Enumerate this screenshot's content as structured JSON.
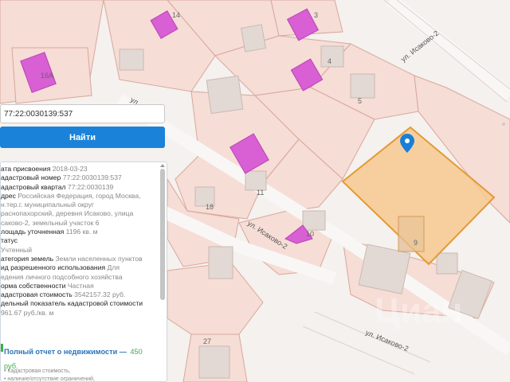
{
  "search": {
    "value": "77:22:0030139:537",
    "button_label": "Найти"
  },
  "streets": [
    "ул. Исаково-2",
    "ул. Исаково-2",
    "ул. Исаково-2",
    "ул."
  ],
  "plot_numbers": [
    "14",
    "3",
    "16А",
    "4",
    "5",
    "11",
    "18",
    "10",
    "9",
    "27"
  ],
  "watermark": "Циан",
  "info": {
    "rows": [
      {
        "label": "ата присвоения",
        "value": "2018-03-23"
      },
      {
        "label": "адастровый номер",
        "value": "77:22:0030139:537"
      },
      {
        "label": "адастровый квартал",
        "value": "77:22:0030139"
      },
      {
        "label": "дрес",
        "value": "Российская Федерация, город Москва,"
      },
      {
        "label": "",
        "value": "н.тер.г. муниципальный округ"
      },
      {
        "label": "",
        "value": "раснопахорский, деревня Исаково, улица"
      },
      {
        "label": "",
        "value": "саково-2, земельный участок 6"
      },
      {
        "label": "лощадь уточненная",
        "value": "1196 кв. м"
      },
      {
        "label": "татус",
        "value": ""
      },
      {
        "label": "",
        "value": "Учтенный"
      },
      {
        "label": "атегория земель",
        "value": "Земли населенных пунктов"
      },
      {
        "label": "ид разрешенного использования",
        "value": "Для"
      },
      {
        "label": "",
        "value": "едения личного подсобного хозяйства"
      },
      {
        "label": "орма собственности",
        "value": "Частная"
      },
      {
        "label": "адастровая стоимость",
        "value": "3542157.32 руб."
      },
      {
        "label": "дельный показатель кадастровой стоимости",
        "value": ""
      },
      {
        "label": "",
        "value": "961.67 руб./кв. м"
      }
    ],
    "report_link": "Полный отчет о недвижимости —",
    "report_price": "450",
    "report_price_unit": "руб.",
    "report_items": [
      "Кадастровая стоимость,",
      "наличие/отсутствие ограничений,"
    ]
  },
  "colors": {
    "parcel": "#f6ddd6",
    "parcel_border": "#d9a79c",
    "building": "#e3d9d4",
    "highlight_fill": "#f7c98f",
    "highlight_border": "#e39a36",
    "pink_building": "#d95fd4",
    "pin": "#1a7fd9",
    "button": "#1a83d9"
  }
}
